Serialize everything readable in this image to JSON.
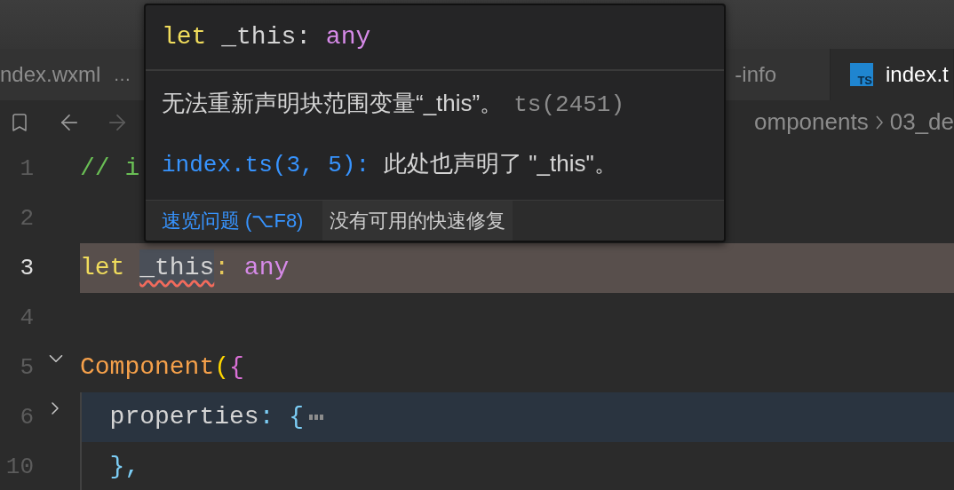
{
  "tabs": [
    {
      "label": "ndex.wxml",
      "description": "…",
      "icon": false,
      "selected": false
    },
    {
      "label": "-info",
      "icon": false,
      "selected": false
    },
    {
      "label": "index.t",
      "icon": "TS",
      "selected": true
    }
  ],
  "breadcrumb": [
    "omponents",
    "03_de"
  ],
  "lines": [
    {
      "number": "1",
      "tokens": [
        {
          "text": "// i",
          "color": "#6abf55"
        }
      ]
    },
    {
      "number": "2"
    },
    {
      "number": "3",
      "current": true,
      "tokens": [
        {
          "text": "let ",
          "color": "#f0dc5c"
        },
        {
          "text": "_this",
          "color": "#d4d4d4",
          "error": true,
          "highlight": true
        },
        {
          "text": ": ",
          "color": "#e6c85a"
        },
        {
          "text": "any",
          "color": "#d68ae8"
        }
      ]
    },
    {
      "number": "4"
    },
    {
      "number": "5",
      "expanded": true,
      "tokens": [
        {
          "text": "Component",
          "color": "#f5a04a"
        },
        {
          "text": "(",
          "color": "#ffd700"
        },
        {
          "text": "{",
          "color": "#da70d6"
        }
      ]
    },
    {
      "number": "6",
      "highlighted": true,
      "expanded": false,
      "guide": true,
      "tokens": [
        {
          "text": "  properties",
          "color": "#d4d4d4"
        },
        {
          "text": ": {",
          "color": "#7ccdf5"
        }
      ]
    },
    {
      "number": "10",
      "guide": true,
      "tokens": [
        {
          "text": "  },",
          "color": "#7ccdf5"
        }
      ]
    }
  ],
  "hover": {
    "signature": [
      {
        "text": "let",
        "color": "#f0dc5c"
      },
      {
        "text": " _this: ",
        "color": "#d4d4d4"
      },
      {
        "text": "any",
        "color": "#d68ae8"
      }
    ],
    "message": "无法重新声明块范围变量“_this”。",
    "code": "ts(2451)",
    "related_link": "index.ts(3, 5):",
    "related_text": "此处也声明了 \"_this\"。",
    "actions": [
      {
        "label": "速览问题 (⌥F8)",
        "kind": "link"
      },
      {
        "label": "没有可用的快速修复",
        "kind": "disabled"
      }
    ]
  }
}
